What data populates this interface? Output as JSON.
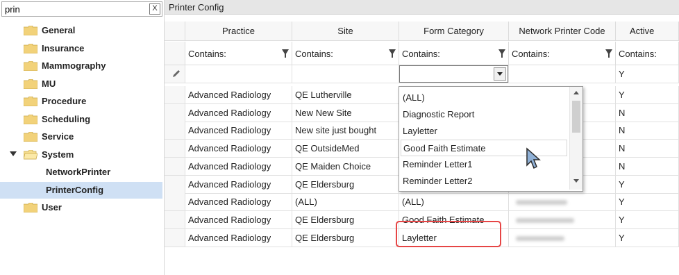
{
  "search": {
    "value": "prin",
    "clear_label": "X"
  },
  "tree": [
    {
      "label": "General"
    },
    {
      "label": "Insurance"
    },
    {
      "label": "Mammography"
    },
    {
      "label": "MU"
    },
    {
      "label": "Procedure"
    },
    {
      "label": "Scheduling"
    },
    {
      "label": "Service"
    },
    {
      "label": "System",
      "expanded": true
    },
    {
      "label": "NetworkPrinter",
      "child": true
    },
    {
      "label": "PrinterConfig",
      "child": true,
      "selected": true
    },
    {
      "label": "User"
    }
  ],
  "grid": {
    "title": "Printer Config",
    "columns": [
      "Practice",
      "Site",
      "Form Category",
      "Network Printer Code",
      "Active"
    ],
    "filter_label": "Contains:",
    "new_row_active": "Y",
    "rows": [
      {
        "practice": "Advanced Radiology",
        "site": "QE Lutherville",
        "form": "",
        "active": "Y"
      },
      {
        "practice": "Advanced Radiology",
        "site": "New New Site",
        "form": "",
        "active": "N"
      },
      {
        "practice": "Advanced Radiology",
        "site": "New site just bought",
        "form": "",
        "active": "N"
      },
      {
        "practice": "Advanced Radiology",
        "site": "QE OutsideMed",
        "form": "",
        "active": "N"
      },
      {
        "practice": "Advanced Radiology",
        "site": "QE Maiden Choice",
        "form": "",
        "active": "N"
      },
      {
        "practice": "Advanced Radiology",
        "site": "QE Eldersburg",
        "form": "",
        "active": "Y"
      },
      {
        "practice": "Advanced Radiology",
        "site": "(ALL)",
        "form": "(ALL)",
        "active": "Y"
      },
      {
        "practice": "Advanced Radiology",
        "site": "QE Eldersburg",
        "form": "Good Faith Estimate",
        "active": "Y"
      },
      {
        "practice": "Advanced Radiology",
        "site": "QE Eldersburg",
        "form": "Layletter",
        "active": "Y"
      }
    ]
  },
  "dropdown": {
    "options": [
      "(ALL)",
      "Diagnostic Report",
      "Layletter",
      "Good Faith Estimate",
      "Reminder Letter1",
      "Reminder Letter2"
    ],
    "hovered": "Good Faith Estimate"
  },
  "colors": {
    "selected_bg": "#cfe0f4",
    "highlight": "#e64545",
    "folder": "#f2d27a"
  }
}
